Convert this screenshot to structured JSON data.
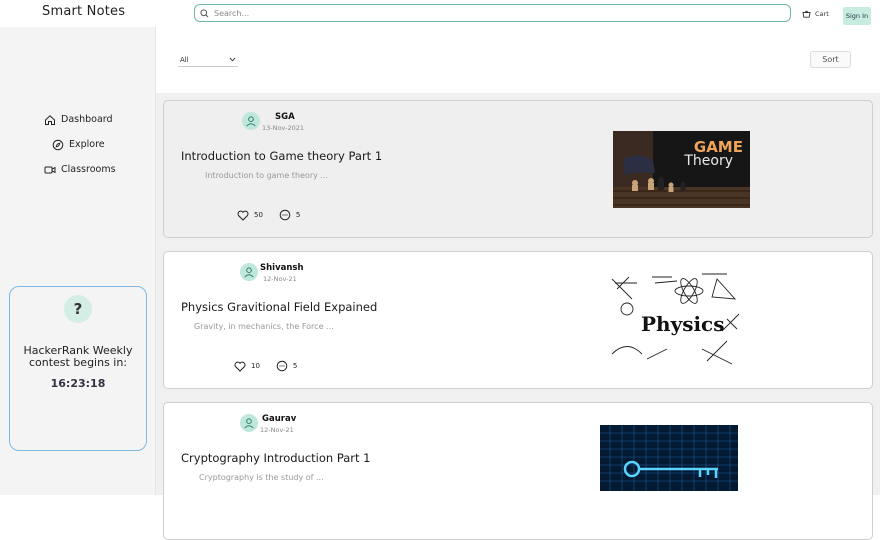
{
  "header": {
    "brand": "Smart Notes",
    "search_placeholder": "Search...",
    "cart_label": "Cart",
    "signin_label": "Sign In"
  },
  "sidebar": {
    "items": [
      {
        "label": "Dashboard",
        "icon": "home-icon"
      },
      {
        "label": "Explore",
        "icon": "compass-icon"
      },
      {
        "label": "Classrooms",
        "icon": "video-icon"
      }
    ],
    "contest": {
      "icon": "?",
      "text": "HackerRank Weekly contest begins in:",
      "countdown": "16:23:18"
    }
  },
  "toolbar": {
    "filter_value": "All",
    "sort_label": "Sort"
  },
  "posts": [
    {
      "author": "SGA",
      "date": "13-Nov-2021",
      "title": "Introduction to Game theory Part 1",
      "excerpt": "Introduction to game theory ...",
      "likes": "50",
      "comments": "5",
      "image_text": [
        "GAME",
        "Theory"
      ]
    },
    {
      "author": "Shivansh",
      "date": "12-Nov-21",
      "title": "Physics Gravitional Field Expained",
      "excerpt": "Gravity, in mechanics, the Force ...",
      "likes": "10",
      "comments": "5",
      "image_text": [
        "Physics"
      ]
    },
    {
      "author": "Gaurav",
      "date": "12-Nov-21",
      "title": "Cryptography Introduction Part 1",
      "excerpt": "Cryptography is the study of ..."
    }
  ],
  "colors": {
    "accent": "#6fb7ad",
    "avatar_bg": "#bfe7dc",
    "signin_bg": "#c8ece0",
    "contest_border": "#7fb8e0"
  }
}
